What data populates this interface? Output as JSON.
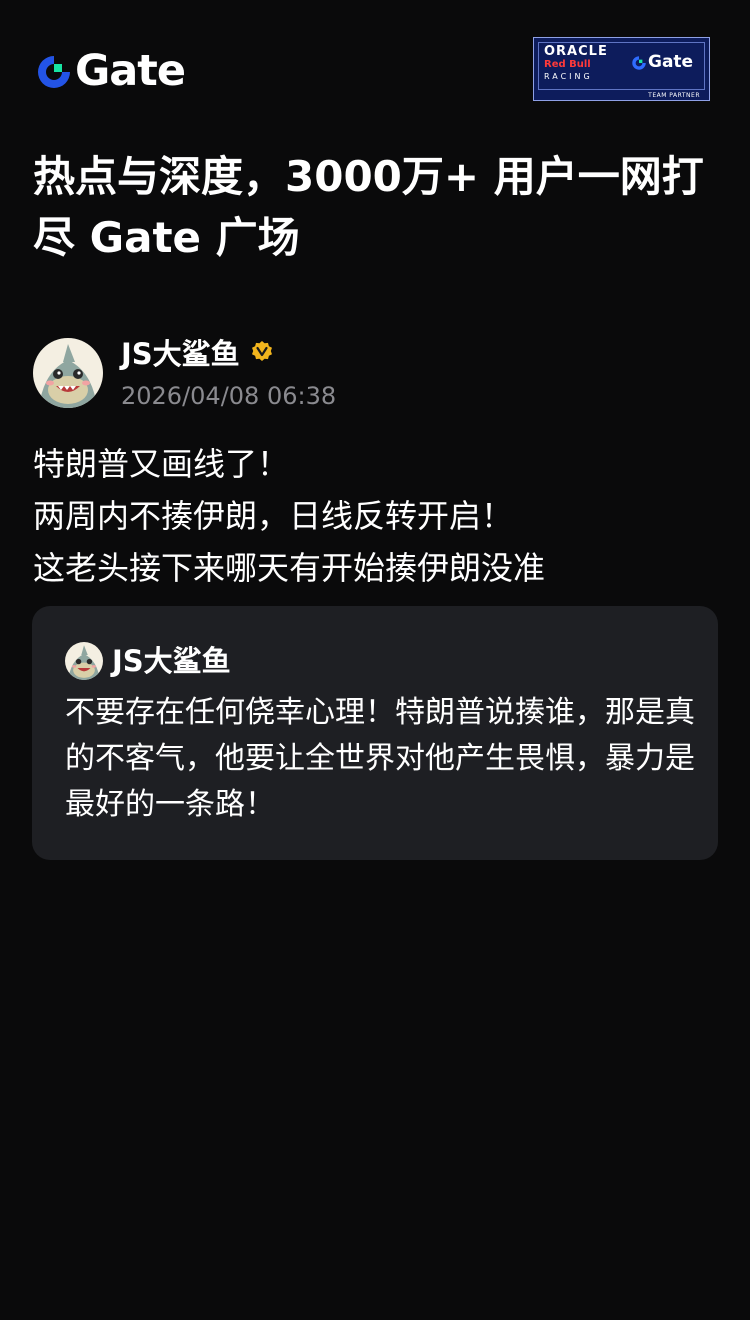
{
  "header": {
    "logo_text": "Gate",
    "partner_badge": {
      "oracle": "ORACLE",
      "redbull": "Red Bull",
      "racing": "RACING",
      "gate": "Gate",
      "caption": "TEAM PARTNER"
    }
  },
  "headline": "热点与深度，3000万+ 用户一网打尽 Gate 广场",
  "post": {
    "author": "JS大鲨鱼",
    "verified_icon": "verified-badge-icon",
    "timestamp": "2026/04/08 06:38",
    "lines": [
      "特朗普又画线了！",
      "两周内不揍伊朗，日线反转开启！",
      "这老头接下来哪天有开始揍伊朗没准"
    ],
    "quote": {
      "author": "JS大鲨鱼",
      "text": "不要存在任何侥幸心理！特朗普说揍谁，那是真的不客气，他要让全世界对他产生畏惧，暴力是最好的一条路！"
    }
  },
  "colors": {
    "background": "#0a0a0b",
    "brand_blue": "#2354e6",
    "brand_green": "#17e5a4",
    "verified_gold": "#f2b51d",
    "quote_bg": "#1e1f23",
    "meta_gray": "#8a8a8f"
  }
}
